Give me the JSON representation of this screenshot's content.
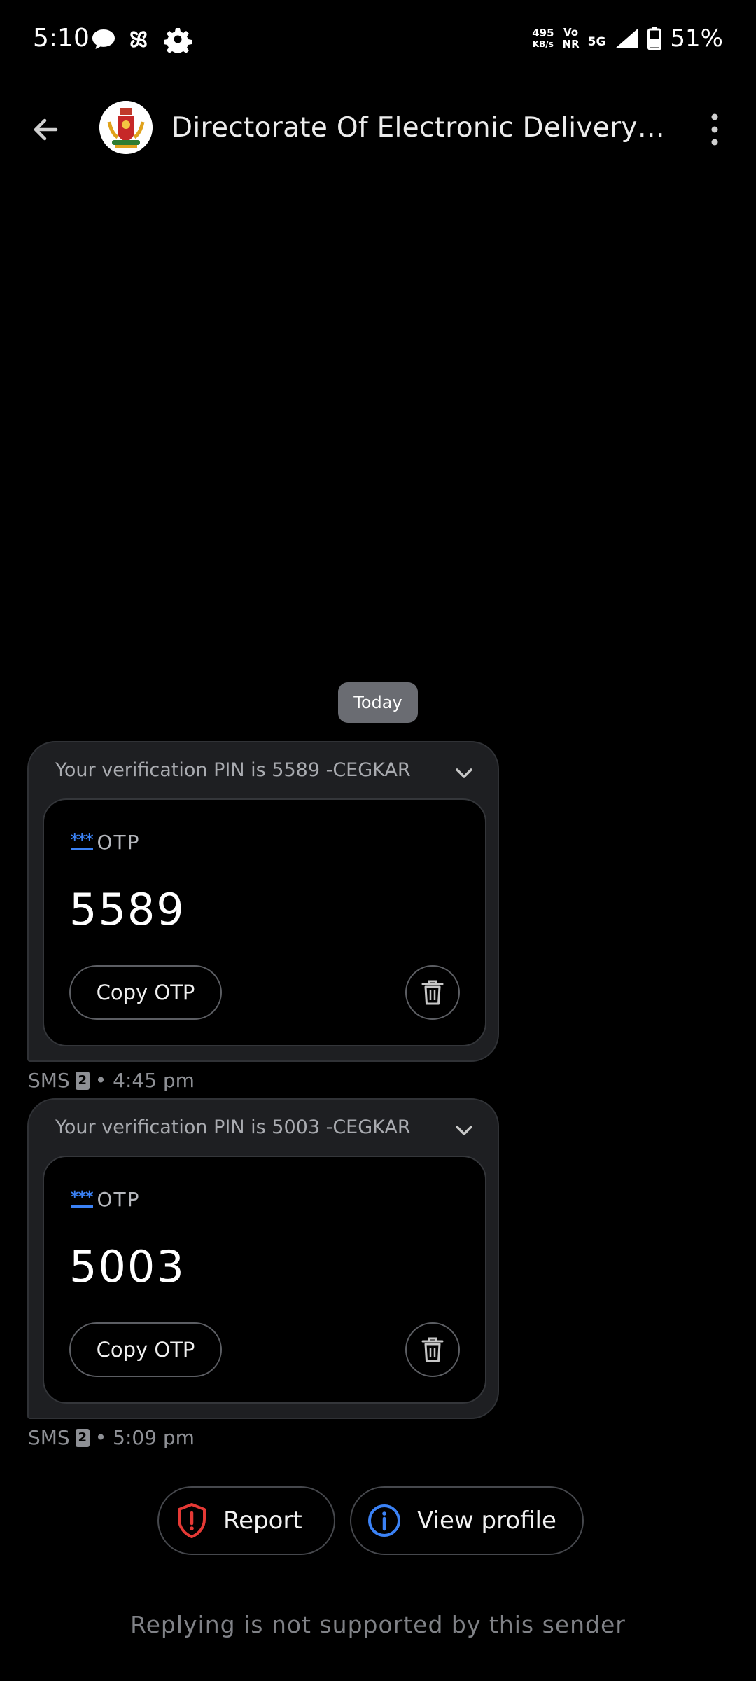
{
  "status_bar": {
    "time": "5:10",
    "speed_value": "495",
    "speed_unit": "KB/s",
    "volte_top": "Vo",
    "volte_bottom": "NR",
    "network": "5G",
    "battery": "51%",
    "icons": [
      "chat-bubble-icon",
      "pinwheel-icon",
      "gear-icon",
      "signal-icon",
      "battery-icon"
    ]
  },
  "header": {
    "title": "Directorate Of Electronic Delivery O...",
    "back_icon": "arrow-left-icon",
    "more_icon": "more-vertical-icon",
    "avatar_icon": "karnataka-emblem-icon"
  },
  "date_chip": "Today",
  "messages": [
    {
      "preview": "Your verification PIN is 5589 -CEGKAR",
      "otp_stars": "***",
      "otp_label": "OTP",
      "otp_code": "5589",
      "copy_label": "Copy OTP",
      "channel": "SMS",
      "sim": "2",
      "time": "• 4:45 pm"
    },
    {
      "preview": "Your verification PIN is 5003 -CEGKAR",
      "otp_stars": "***",
      "otp_label": "OTP",
      "otp_code": "5003",
      "copy_label": "Copy OTP",
      "channel": "SMS",
      "sim": "2",
      "time": "• 5:09 pm"
    }
  ],
  "actions": {
    "report_label": "Report",
    "view_profile_label": "View profile"
  },
  "footer": "Replying is not supported by this sender",
  "colors": {
    "background": "#000000",
    "bubble": "#1e1f22",
    "accent_blue": "#3b82f6",
    "report_red": "#e53935"
  }
}
